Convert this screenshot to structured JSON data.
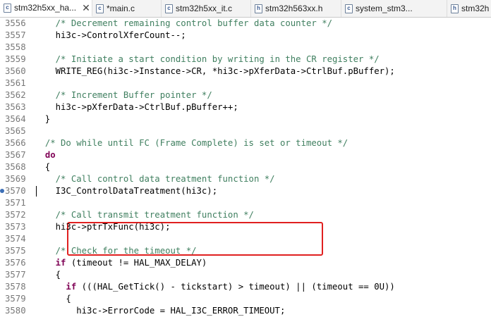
{
  "tabs": [
    {
      "label": "stm32h5xx_ha...",
      "icon": "c",
      "active": true,
      "closable": true
    },
    {
      "label": "*main.c",
      "icon": "c",
      "active": false
    },
    {
      "label": "stm32h5xx_it.c",
      "icon": "c",
      "active": false
    },
    {
      "label": "stm32h563xx.h",
      "icon": "h",
      "active": false
    },
    {
      "label": "system_stm3...",
      "icon": "c",
      "active": false
    },
    {
      "label": "stm32h",
      "icon": "h",
      "active": false
    }
  ],
  "close_glyph": "✕",
  "lines": [
    {
      "n": "3556",
      "segs": [
        [
          "    ",
          ""
        ],
        [
          "/* Decrement remaining control buffer data counter */",
          "cm"
        ]
      ]
    },
    {
      "n": "3557",
      "segs": [
        [
          "    hi3c->ControlXferCount--;",
          ""
        ]
      ]
    },
    {
      "n": "3558",
      "segs": []
    },
    {
      "n": "3559",
      "segs": [
        [
          "    ",
          ""
        ],
        [
          "/* Initiate a start condition by writing in the CR register */",
          "cm"
        ]
      ]
    },
    {
      "n": "3560",
      "segs": [
        [
          "    WRITE_REG(hi3c->Instance->CR, *hi3c->pXferData->CtrlBuf.pBuffer);",
          ""
        ]
      ]
    },
    {
      "n": "3561",
      "segs": []
    },
    {
      "n": "3562",
      "segs": [
        [
          "    ",
          ""
        ],
        [
          "/* Increment Buffer pointer */",
          "cm"
        ]
      ]
    },
    {
      "n": "3563",
      "segs": [
        [
          "    hi3c->pXferData->CtrlBuf.pBuffer++;",
          ""
        ]
      ]
    },
    {
      "n": "3564",
      "segs": [
        [
          "  }",
          ""
        ]
      ]
    },
    {
      "n": "3565",
      "segs": []
    },
    {
      "n": "3566",
      "segs": [
        [
          "  ",
          ""
        ],
        [
          "/* Do while until FC (Frame Complete) is set or timeout */",
          "cm"
        ]
      ]
    },
    {
      "n": "3567",
      "segs": [
        [
          "  ",
          ""
        ],
        [
          "do",
          "kw"
        ]
      ]
    },
    {
      "n": "3568",
      "segs": [
        [
          "  {",
          ""
        ]
      ]
    },
    {
      "n": "3569",
      "segs": [
        [
          "    ",
          ""
        ],
        [
          "/* Call control data treatment function */",
          "cm"
        ]
      ]
    },
    {
      "n": "3570",
      "segs": [
        [
          "    I3C_ControlDataTreatment(hi3c);",
          ""
        ]
      ],
      "breakpoint": true,
      "cursor": true
    },
    {
      "n": "3571",
      "segs": []
    },
    {
      "n": "3572",
      "segs": [
        [
          "    ",
          ""
        ],
        [
          "/* Call transmit treatment function */",
          "cm"
        ]
      ]
    },
    {
      "n": "3573",
      "segs": [
        [
          "    hi3c->ptrTxFunc(hi3c);",
          ""
        ]
      ]
    },
    {
      "n": "3574",
      "segs": []
    },
    {
      "n": "3575",
      "segs": [
        [
          "    ",
          ""
        ],
        [
          "/* Check for the timeout */",
          "cm"
        ]
      ]
    },
    {
      "n": "3576",
      "segs": [
        [
          "    ",
          ""
        ],
        [
          "if",
          "kw"
        ],
        [
          " (timeout != HAL_MAX_DELAY)",
          ""
        ]
      ]
    },
    {
      "n": "3577",
      "segs": [
        [
          "    {",
          ""
        ]
      ]
    },
    {
      "n": "3578",
      "segs": [
        [
          "      ",
          ""
        ],
        [
          "if",
          "kw"
        ],
        [
          " (((HAL_GetTick() - tickstart) > timeout) || (timeout == 0U))",
          ""
        ]
      ]
    },
    {
      "n": "3579",
      "segs": [
        [
          "      {",
          ""
        ]
      ]
    },
    {
      "n": "3580",
      "segs": [
        [
          "        hi3c->ErrorCode = HAL_I3C_ERROR_TIMEOUT;",
          ""
        ]
      ]
    }
  ],
  "colors": {
    "comment": "#3f7f5f",
    "keyword": "#7f0055",
    "highlight_box": "#e02020",
    "breakpoint": "#3c6fb6"
  }
}
